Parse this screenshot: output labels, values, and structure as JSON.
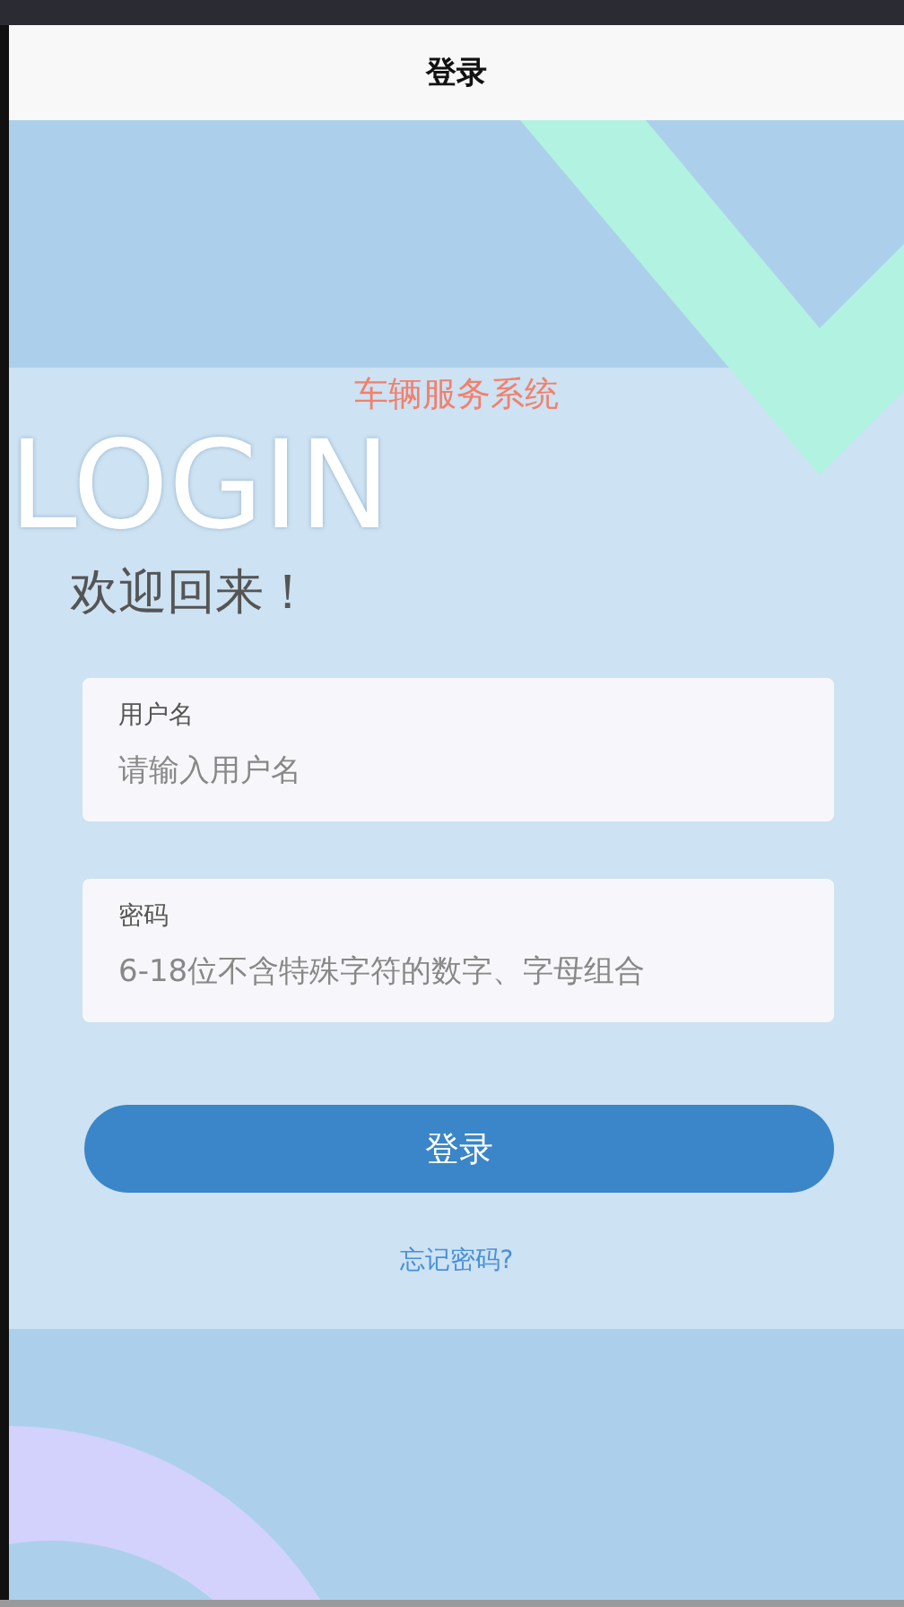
{
  "header": {
    "title": "登录"
  },
  "app_name": "车辆服务系统",
  "background_text": "LOGIN",
  "welcome": "欢迎回来！",
  "fields": [
    {
      "label": "用户名",
      "placeholder": "请输入用户名"
    },
    {
      "label": "密码",
      "placeholder": "6-18位不含特殊字符的数字、字母组合"
    }
  ],
  "login_button": "登录",
  "forgot_link": "忘记密码?"
}
